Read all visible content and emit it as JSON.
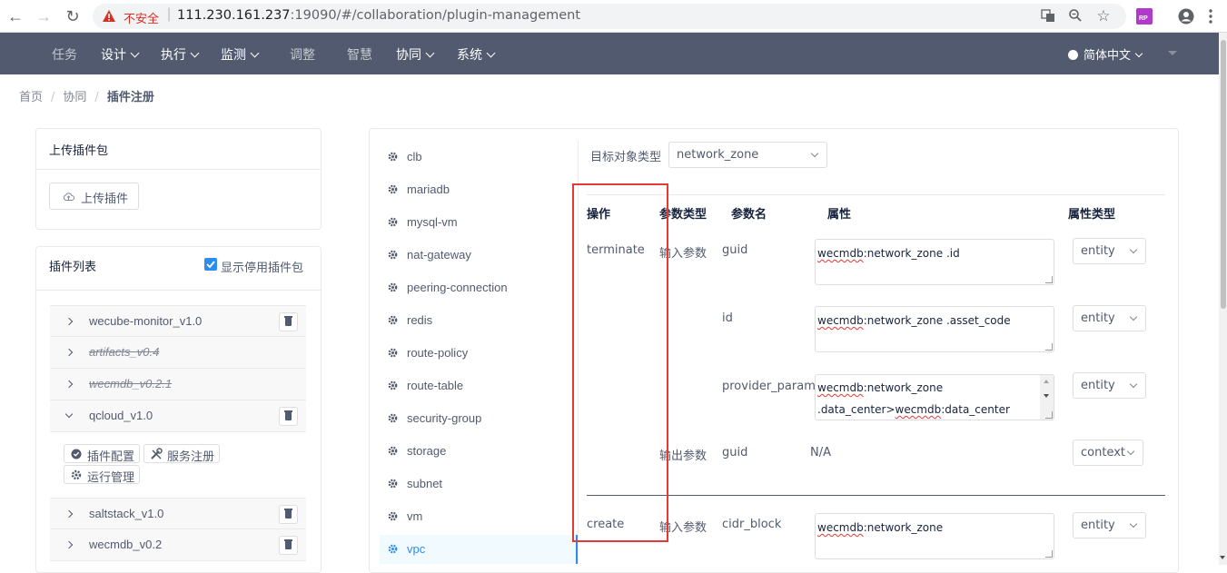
{
  "browser": {
    "insecure_label": "不安全",
    "url_host": "111.230.161.237",
    "url_rest": ":19090/#/collaboration/plugin-management",
    "ext_badge": "RP"
  },
  "topnav": {
    "items": [
      {
        "label": "任务"
      },
      {
        "label": "设计"
      },
      {
        "label": "执行"
      },
      {
        "label": "监测"
      },
      {
        "label": "调整"
      },
      {
        "label": "智慧"
      },
      {
        "label": "协同"
      },
      {
        "label": "系统"
      }
    ],
    "language": "简体中文"
  },
  "breadcrumb": [
    "首页",
    "协同",
    "插件注册"
  ],
  "upload_card": {
    "title": "上传插件包",
    "button": "上传插件"
  },
  "plugin_list": {
    "title": "插件列表",
    "show_disabled_label": "显示停用插件包",
    "show_disabled_checked": true,
    "items": [
      {
        "name": "wecube-monitor_v1.0"
      },
      {
        "name": "artifacts_v0.4"
      },
      {
        "name": "wecmdb_v0.2.1"
      },
      {
        "name": "qcloud_v1.0"
      },
      {
        "name": "saltstack_v1.0"
      },
      {
        "name": "wecmdb_v0.2"
      }
    ],
    "actions": {
      "config": "插件配置",
      "service_register": "服务注册",
      "runtime": "运行管理"
    }
  },
  "resources": {
    "items": [
      "clb",
      "mariadb",
      "mysql-vm",
      "nat-gateway",
      "peering-connection",
      "redis",
      "route-policy",
      "route-table",
      "security-group",
      "storage",
      "subnet",
      "vm",
      "vpc"
    ],
    "active": "vpc"
  },
  "config": {
    "target_label": "目标对象类型",
    "target_value": "network_zone",
    "headers": {
      "op": "操作",
      "param_type": "参数类型",
      "param_name": "参数名",
      "attr": "属性",
      "attr_type": "属性类型"
    },
    "rows": {
      "r1": {
        "op": "terminate",
        "param_type": "输入参数",
        "name": "guid",
        "attr_prefix": "wecmdb",
        "attr_rest": ":network_zone .id",
        "type": "entity"
      },
      "r2": {
        "name": "id",
        "attr_prefix": "wecmdb",
        "attr_rest": ":network_zone .asset_code",
        "type": "entity"
      },
      "r3": {
        "name": "provider_params",
        "attr_prefix": "wecmdb",
        "attr_rest": ":network_zone",
        "attr_line2_a": ".data_center>",
        "attr_line2_b": "wecmdb",
        "attr_line2_c": ":data_center",
        "type": "entity"
      },
      "r4": {
        "param_type": "输出参数",
        "name": "guid",
        "attr": "N/A",
        "type": "context"
      },
      "r5": {
        "op": "create",
        "param_type": "输入参数",
        "name": "cidr_block",
        "attr_prefix": "wecmdb",
        "attr_rest": ":network_zone",
        "type": "entity"
      }
    }
  }
}
